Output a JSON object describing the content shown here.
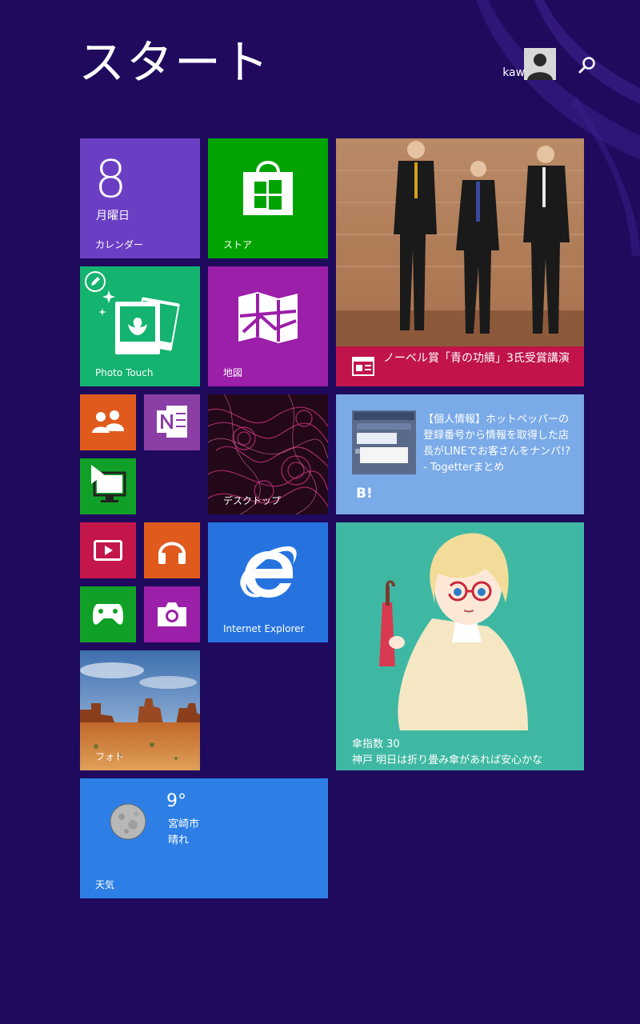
{
  "header": {
    "title": "スタート",
    "user_first": "k",
    "user_last": "kawauchi"
  },
  "tiles": {
    "calendar": {
      "day": "8",
      "weekday": "月曜日",
      "label": "カレンダー"
    },
    "store": {
      "label": "ストア"
    },
    "photo_touch": {
      "label": "Photo Touch"
    },
    "maps": {
      "label": "地図"
    },
    "desktop": {
      "label": "デスクトップ"
    },
    "news": {
      "headline": "ノーベル賞「青の功績」3氏受賞講演"
    },
    "hatena": {
      "text": "【個人情報】ホットペッパーの登録番号から情報を取得した店長がLINEでお客さんをナンパ!? - Togetterまとめ",
      "logo": "B!"
    },
    "ie": {
      "label": "Internet Explorer"
    },
    "anime": {
      "line1": "傘指数 30",
      "line2": "神戸 明日は折り畳み傘があれば安心かな"
    },
    "photos": {
      "label": "フォト"
    },
    "weather": {
      "temp": "9°",
      "city": "宮崎市",
      "condition": "晴れ",
      "label": "天気"
    }
  },
  "colors": {
    "background": "#1f0a5e",
    "calendar": "#6b3fc4",
    "store": "#00a300",
    "photo_touch": "#14b36f",
    "maps": "#9b1fa8",
    "people": "#e05a1e",
    "onenote": "#8b3ea6",
    "remote_desktop": "#11a027",
    "video": "#c4164b",
    "music": "#e05a1e",
    "games": "#11a027",
    "camera": "#9b1fa8",
    "ie": "#2673e0",
    "hatena": "#7aaae8",
    "anime": "#3fb8a3",
    "weather": "#2d7fe6",
    "news_caption": "#c0144a"
  }
}
